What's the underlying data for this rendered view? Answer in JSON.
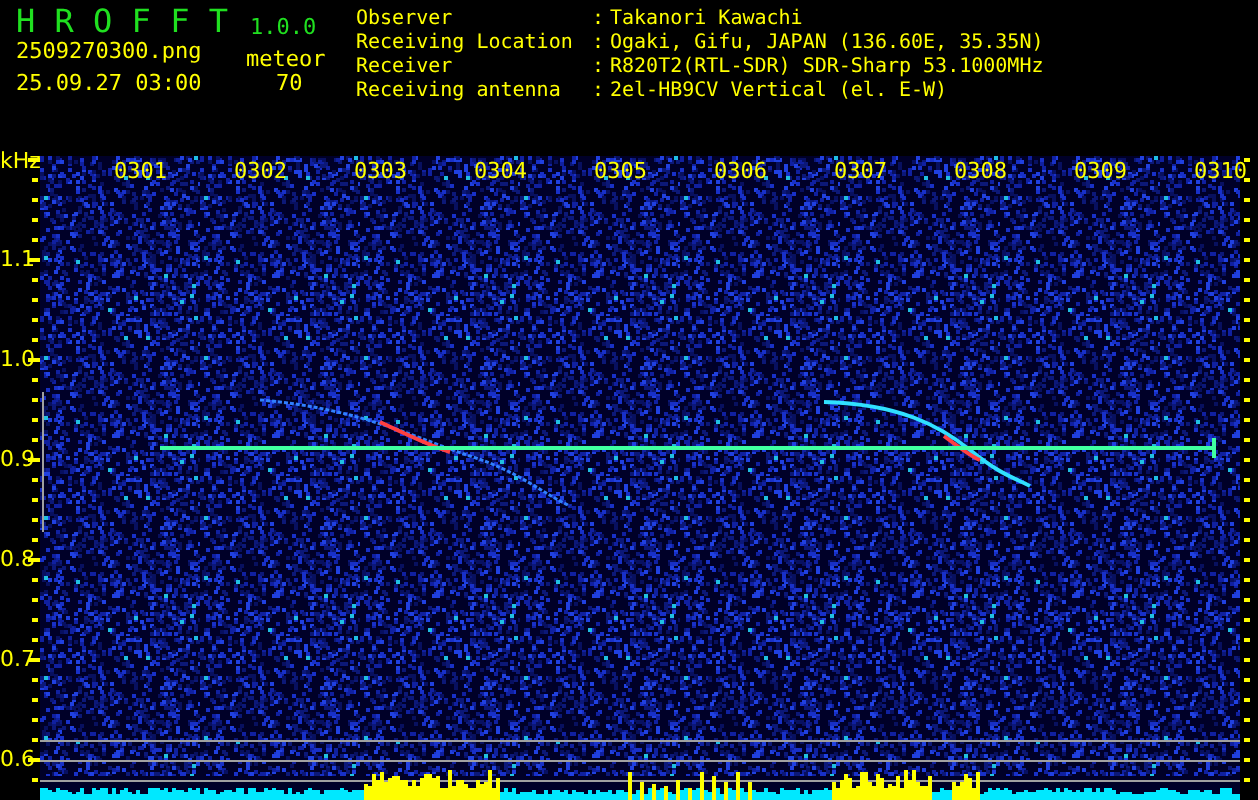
{
  "header": {
    "title": "H R O F F T",
    "version": "1.0.0",
    "filename": "2509270300.png",
    "datetime": "25.09.27 03:00",
    "count_label": "meteor",
    "count": "70"
  },
  "info": [
    {
      "label": "Observer",
      "separator": ":",
      "value": "Takanori Kawachi"
    },
    {
      "label": "Receiving Location",
      "separator": ":",
      "value": "Ogaki, Gifu, JAPAN (136.60E, 35.35N)"
    },
    {
      "label": "Receiver",
      "separator": ":",
      "value": "R820T2(RTL-SDR) SDR-Sharp 53.1000MHz"
    },
    {
      "label": "Receiving antenna",
      "separator": ":",
      "value": "2el-HB9CV Vertical (el. E-W)"
    }
  ],
  "plot": {
    "unit": "kHz",
    "time_labels": [
      "0301",
      "0302",
      "0303",
      "0304",
      "0305",
      "0306",
      "0307",
      "0308",
      "0309",
      "0310"
    ],
    "freq_labels": [
      "1.1",
      "1.0",
      "0.9",
      "0.8",
      "0.7",
      "0.6"
    ]
  }
}
